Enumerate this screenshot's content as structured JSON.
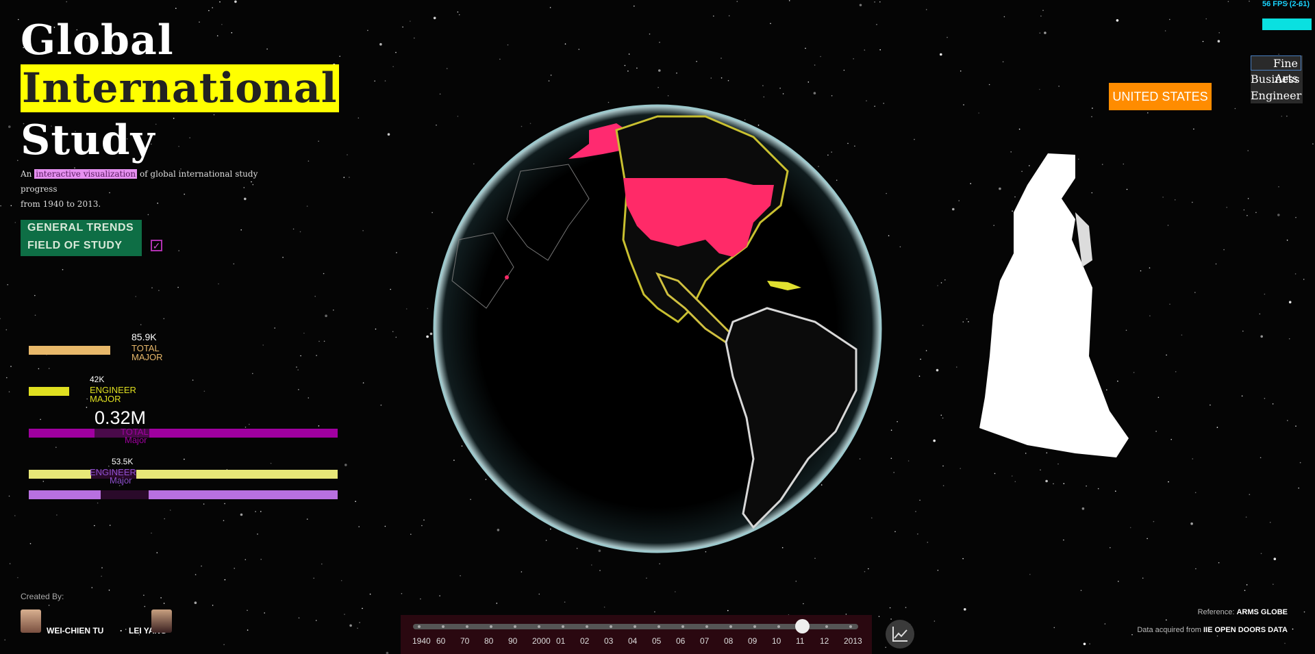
{
  "title": {
    "word1": "Global",
    "word2": "International",
    "word3": "Study",
    "subtitle_pre": "An",
    "subtitle_highlight": "interactive visualization",
    "subtitle_post": "of global international study progress",
    "subtitle_line2": "from 1940 to 2013."
  },
  "menu": {
    "general_trends": "GENERAL TRENDS",
    "field_of_study": "FIELD OF STUDY",
    "checkbox_mark": "✓",
    "field_of_study_checked": true
  },
  "stats": {
    "total_value": "85.9K",
    "total_label_1": "TOTAL",
    "total_label_2": "MAJOR",
    "engineer_value": "42K",
    "engineer_label_1": "ENGINEER",
    "engineer_label_2": "MAJOR",
    "big_total": "0.32M",
    "total_major_1": "TOTAL",
    "total_major_2": "Major",
    "engineer_value_2": "53.5K",
    "engineer_major_1": "ENGINEER",
    "engineer_major_2": "Major"
  },
  "hud": {
    "fps": "56 FPS (2-61)"
  },
  "country": "UNITED STATES",
  "majors": {
    "options": [
      "Fine Arts",
      "Business",
      "Engineer"
    ],
    "selected": "Fine Arts"
  },
  "footer": {
    "created_by": "Created By:",
    "author1": "WEI-CHIEN TU",
    "author2": "LEI YANG",
    "reference_label": "Reference:",
    "reference_value": "ARMS GLOBE",
    "data_label": "Data acquired from",
    "data_value": "IIE OPEN DOORS DATA"
  },
  "timeline": {
    "ticks": [
      "1940",
      "60",
      "70",
      "80",
      "90",
      "2000",
      "01",
      "02",
      "03",
      "04",
      "05",
      "06",
      "07",
      "08",
      "09",
      "10",
      "11",
      "12",
      "2013"
    ],
    "selected": "11"
  },
  "colors": {
    "title_highlight": "#ffff00",
    "menu_bg": "#0e6e45",
    "country_btn": "#ff8c00",
    "total_bar": "#e8b86a",
    "engineer_bar": "#e0e020",
    "purple_bar": "#a000a0",
    "yellow_bar": "#e8e878",
    "lilac_bar": "#b870e0",
    "fps": "#19d4ff",
    "globe_highlight": "#ff2060"
  }
}
